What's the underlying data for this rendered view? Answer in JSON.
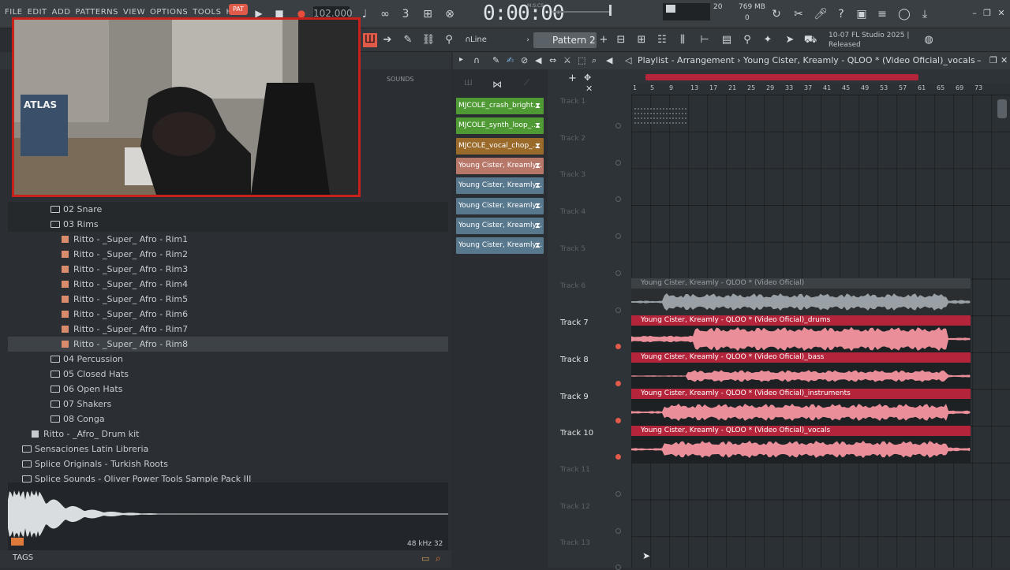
{
  "menu": [
    "FILE",
    "EDIT",
    "ADD",
    "PATTERNS",
    "VIEW",
    "OPTIONS",
    "TOOLS",
    "HELP"
  ],
  "transport": {
    "pat_label": "PAT",
    "tempo": "102.000",
    "time": "0:00:00",
    "time_unit": "M:S:CS"
  },
  "monitor": {
    "cpu": "20",
    "memory": "769 MB",
    "polyphony": "0"
  },
  "toolbar2": {
    "snap": "Line",
    "pattern": "Pattern 2",
    "hint_date": "10-07",
    "hint_line1": "FL Studio 2025 |",
    "hint_line2": "Released"
  },
  "browser": {
    "sounds_tab": "SOUNDS",
    "items": [
      {
        "label": "02 Snare",
        "type": "folder",
        "indent": 1
      },
      {
        "label": "03 Rims",
        "type": "folder",
        "indent": 1
      },
      {
        "label": "Ritto - _Super_ Afro - Rim1",
        "type": "file",
        "indent": 2
      },
      {
        "label": "Ritto - _Super_ Afro - Rim2",
        "type": "file",
        "indent": 2
      },
      {
        "label": "Ritto - _Super_ Afro - Rim3",
        "type": "file",
        "indent": 2
      },
      {
        "label": "Ritto - _Super_ Afro - Rim4",
        "type": "file",
        "indent": 2
      },
      {
        "label": "Ritto - _Super_ Afro - Rim5",
        "type": "file",
        "indent": 2
      },
      {
        "label": "Ritto - _Super_ Afro - Rim6",
        "type": "file",
        "indent": 2
      },
      {
        "label": "Ritto - _Super_ Afro - Rim7",
        "type": "file",
        "indent": 2
      },
      {
        "label": "Ritto - _Super_ Afro - Rim8",
        "type": "file",
        "indent": 2
      },
      {
        "label": "04 Percussion",
        "type": "folder",
        "indent": 1
      },
      {
        "label": "05 Closed Hats",
        "type": "folder",
        "indent": 1
      },
      {
        "label": "06 Open Hats",
        "type": "folder",
        "indent": 1
      },
      {
        "label": "07 Shakers",
        "type": "folder",
        "indent": 1
      },
      {
        "label": "08 Conga",
        "type": "folder",
        "indent": 1
      },
      {
        "label": "Ritto - _Afro_ Drum kit",
        "type": "kit",
        "indent": 0
      },
      {
        "label": "Sensaciones Latin Libreria",
        "type": "folder",
        "indent": 0
      },
      {
        "label": "Splice Originals - Turkish Roots",
        "type": "folder",
        "indent": 0
      },
      {
        "label": "Splice Sounds - Oliver Power Tools Sample Pack III",
        "type": "folder",
        "indent": 0
      }
    ],
    "samplerate": "48 kHz 32",
    "tags_label": "TAGS"
  },
  "playlist": {
    "title": "Playlist - Arrangement › Young Cister, Kreamly - QLOO * (Video Oficial)_vocals",
    "clips": [
      {
        "label": "MJCOLE_crash_bright...",
        "color": "green"
      },
      {
        "label": "MJCOLE_synth_loop_...",
        "color": "green"
      },
      {
        "label": "MJCOLE_vocal_chop_...",
        "color": "orange"
      },
      {
        "label": "Young Cister, Kreamly...",
        "color": "peach"
      },
      {
        "label": "Young Cister, Kreamly...",
        "color": "blue"
      },
      {
        "label": "Young Cister, Kreamly...",
        "color": "blue"
      },
      {
        "label": "Young Cister, Kreamly...",
        "color": "blue"
      },
      {
        "label": "Young Cister, Kreamly...",
        "color": "blue"
      }
    ],
    "ruler": [
      "1",
      "5",
      "9",
      "13",
      "17",
      "21",
      "25",
      "29",
      "33",
      "37",
      "41",
      "45",
      "49",
      "53",
      "57",
      "61",
      "65",
      "69",
      "73"
    ],
    "tracks": [
      {
        "label": "Track 1",
        "active": false
      },
      {
        "label": "Track 2",
        "active": false
      },
      {
        "label": "Track 3",
        "active": false
      },
      {
        "label": "Track 4",
        "active": false
      },
      {
        "label": "Track 5",
        "active": false
      },
      {
        "label": "Track 6",
        "active": false
      },
      {
        "label": "Track 7",
        "active": true
      },
      {
        "label": "Track 8",
        "active": true
      },
      {
        "label": "Track 9",
        "active": true
      },
      {
        "label": "Track 10",
        "active": true
      },
      {
        "label": "Track 11",
        "active": false
      },
      {
        "label": "Track 12",
        "active": false
      },
      {
        "label": "Track 13",
        "active": false
      }
    ],
    "lanes": [
      {
        "label": "Young Cister, Kreamly - QLOO * (Video Oficial)",
        "muted": true
      },
      {
        "label": "Young Cister, Kreamly - QLOO * (Video Oficial)_drums",
        "muted": false
      },
      {
        "label": "Young Cister, Kreamly - QLOO * (Video Oficial)_bass",
        "muted": false
      },
      {
        "label": "Young Cister, Kreamly - QLOO * (Video Oficial)_instruments",
        "muted": false
      },
      {
        "label": "Young Cister, Kreamly - QLOO * (Video Oficial)_vocals",
        "muted": false
      }
    ]
  }
}
